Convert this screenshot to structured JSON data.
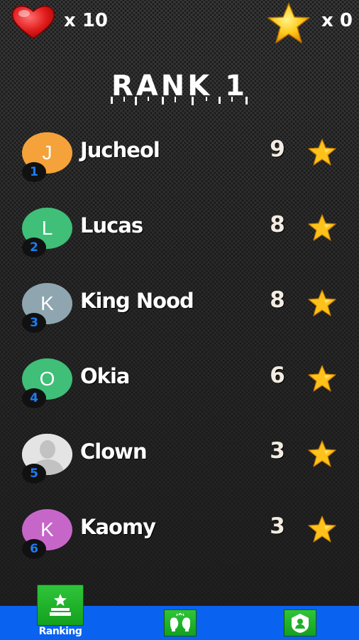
{
  "hud": {
    "lives_icon": "heart-icon",
    "lives_count": "x 10",
    "stars_icon": "star-icon",
    "stars_count": "x 0"
  },
  "title": "RANK 1",
  "players": [
    {
      "rank": "1",
      "initial": "J",
      "name": "Jucheol",
      "score": "9",
      "color": "#f5a23a"
    },
    {
      "rank": "2",
      "initial": "L",
      "name": "Lucas",
      "score": "8",
      "color": "#3fbf78"
    },
    {
      "rank": "3",
      "initial": "K",
      "name": "King Nood",
      "score": "8",
      "color": "#8fa6b0"
    },
    {
      "rank": "4",
      "initial": "O",
      "name": "Okia",
      "score": "6",
      "color": "#3fbf78"
    },
    {
      "rank": "5",
      "initial": "",
      "name": "Clown",
      "score": "3",
      "color": "#e6e6e6",
      "photo": "person-silhouette-icon"
    },
    {
      "rank": "6",
      "initial": "K",
      "name": "Kaomy",
      "score": "3",
      "color": "#c766c9"
    }
  ],
  "nav": {
    "ranking_label": "Ranking",
    "ranking_icon": "ranking-podium-icon",
    "middle_icon": "boxing-gloves-icon",
    "right_icon": "profile-icon",
    "bar_color": "#0a62f0",
    "button_color": "#1faf2a"
  }
}
